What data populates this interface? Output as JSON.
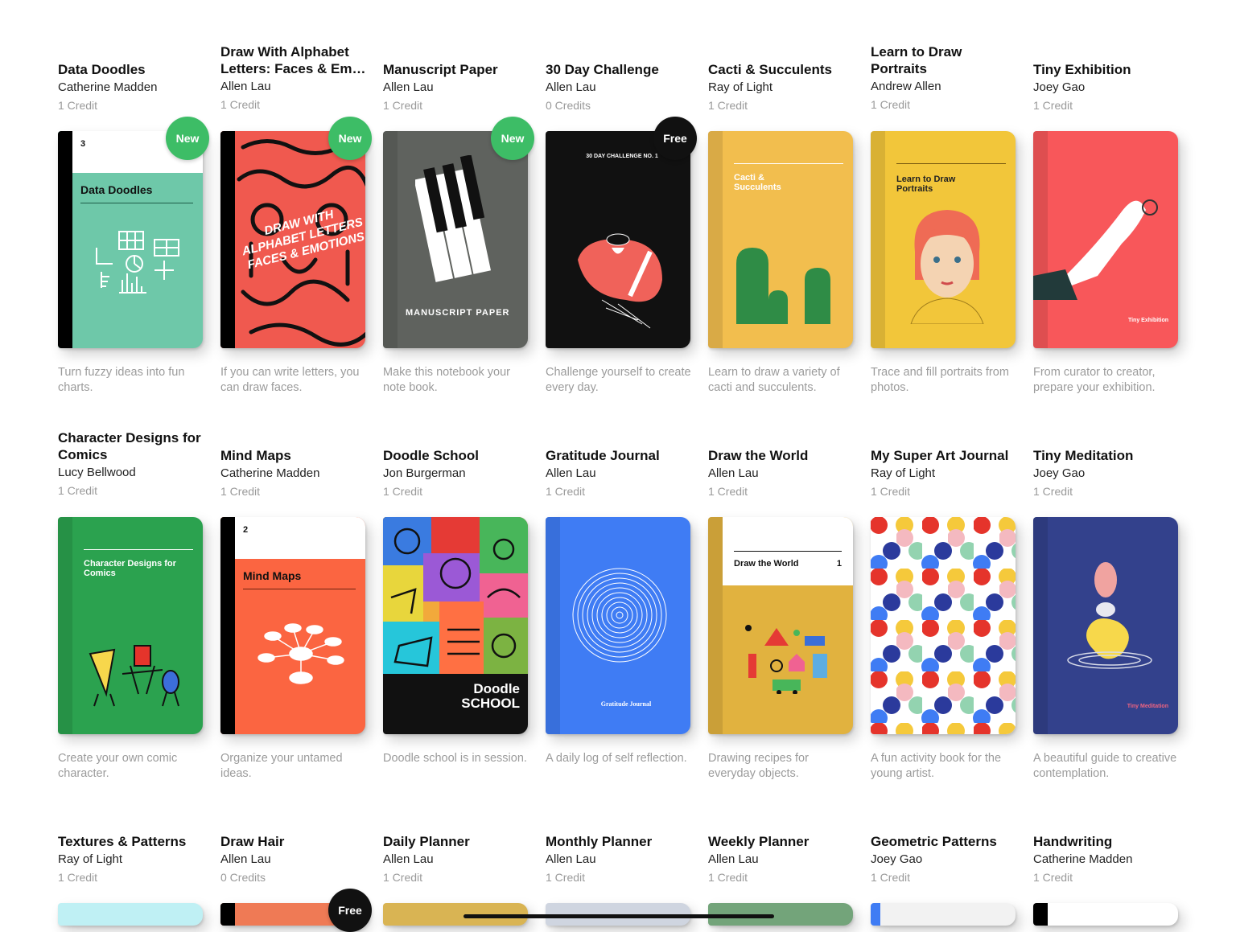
{
  "rows": [
    [
      {
        "title": "Data Doodles",
        "author": "Catherine Madden",
        "credits": "1 Credit",
        "desc": "Turn fuzzy ideas into fun charts.",
        "badge": "New",
        "cover": "#6ec8a9",
        "cover_title": "Data Doodles"
      },
      {
        "title": "Draw With Alphabet Letters: Faces & Em…",
        "author": "Allen Lau",
        "credits": "1 Credit",
        "desc": "If you can write letters, you can draw faces.",
        "badge": "New",
        "cover": "#f0594f",
        "cover_title": "DRAW WITH ALPHABET LETTERS FACES & EMOTIONS"
      },
      {
        "title": "Manuscript Paper",
        "author": "Allen Lau",
        "credits": "1 Credit",
        "desc": "Make this notebook your note book.",
        "badge": "New",
        "cover": "#5f625e",
        "cover_title": "MANUSCRIPT PAPER"
      },
      {
        "title": "30 Day Challenge",
        "author": "Allen Lau",
        "credits": "0 Credits",
        "desc": "Challenge yourself to create every day.",
        "badge": "Free",
        "cover": "#111111",
        "cover_title": "30 DAY CHALLENGE NO. 1"
      },
      {
        "title": "Cacti & Succulents",
        "author": "Ray of Light",
        "credits": "1 Credit",
        "desc": "Learn to draw a variety of cacti and succulents.",
        "badge": "",
        "cover": "#f2be4e",
        "cover_title": "Cacti & Succulents"
      },
      {
        "title": "Learn to Draw Portraits",
        "author": "Andrew Allen",
        "credits": "1 Credit",
        "desc": "Trace and fill portraits from photos.",
        "badge": "",
        "cover": "#f2c63a",
        "cover_title": "Learn to Draw Portraits"
      },
      {
        "title": "Tiny Exhibition",
        "author": "Joey Gao",
        "credits": "1 Credit",
        "desc": "From curator to creator, prepare your exhibition.",
        "badge": "",
        "cover": "#f8575a",
        "cover_title": "Tiny Exhibition"
      }
    ],
    [
      {
        "title": "Character Designs for Comics",
        "author": "Lucy Bellwood",
        "credits": "1 Credit",
        "desc": "Create your own comic character.",
        "badge": "",
        "cover": "#2ba24f",
        "cover_title": "Character Designs for Comics"
      },
      {
        "title": "Mind Maps",
        "author": "Catherine Madden",
        "credits": "1 Credit",
        "desc": "Organize your untamed ideas.",
        "badge": "",
        "cover": "#fb6541",
        "cover_title": "Mind Maps"
      },
      {
        "title": "Doodle School",
        "author": "Jon Burgerman",
        "credits": "1 Credit",
        "desc": "Doodle school is in session.",
        "badge": "",
        "cover": "#111111",
        "cover_title": "Doodle SCHOOL"
      },
      {
        "title": "Gratitude Journal",
        "author": "Allen Lau",
        "credits": "1 Credit",
        "desc": "A daily log of self reflection.",
        "badge": "",
        "cover": "#3f7cf4",
        "cover_title": "Gratitude Journal"
      },
      {
        "title": "Draw the World",
        "author": "Allen Lau",
        "credits": "1 Credit",
        "desc": "Drawing recipes for everyday objects.",
        "badge": "",
        "cover": "#e1b23f",
        "cover_title": "Draw the World"
      },
      {
        "title": "My Super Art Journal",
        "author": "Ray of Light",
        "credits": "1 Credit",
        "desc": "A fun activity book for the young artist.",
        "badge": "",
        "cover": "#ffffff",
        "cover_title": ""
      },
      {
        "title": "Tiny Meditation",
        "author": "Joey Gao",
        "credits": "1 Credit",
        "desc": "A beautiful guide to creative contemplation.",
        "badge": "",
        "cover": "#33418c",
        "cover_title": "Tiny Meditation"
      }
    ],
    [
      {
        "title": "Textures & Patterns",
        "author": "Ray of Light",
        "credits": "1 Credit",
        "badge": "",
        "cover": "#bff0f4"
      },
      {
        "title": "Draw Hair",
        "author": "Allen Lau",
        "credits": "0 Credits",
        "badge": "Free",
        "cover": "#ef7a55"
      },
      {
        "title": "Daily Planner",
        "author": "Allen Lau",
        "credits": "1 Credit",
        "badge": "",
        "cover": "#d9b453"
      },
      {
        "title": "Monthly Planner",
        "author": "Allen Lau",
        "credits": "1 Credit",
        "badge": "",
        "cover": "#cfd5e0"
      },
      {
        "title": "Weekly Planner",
        "author": "Allen Lau",
        "credits": "1 Credit",
        "badge": "",
        "cover": "#73a47a"
      },
      {
        "title": "Geometric Patterns",
        "author": "Joey Gao",
        "credits": "1 Credit",
        "badge": "",
        "cover": "#f2f2f2"
      },
      {
        "title": "Handwriting",
        "author": "Catherine Madden",
        "credits": "1 Credit",
        "badge": "",
        "cover": "#ffffff"
      }
    ]
  ]
}
